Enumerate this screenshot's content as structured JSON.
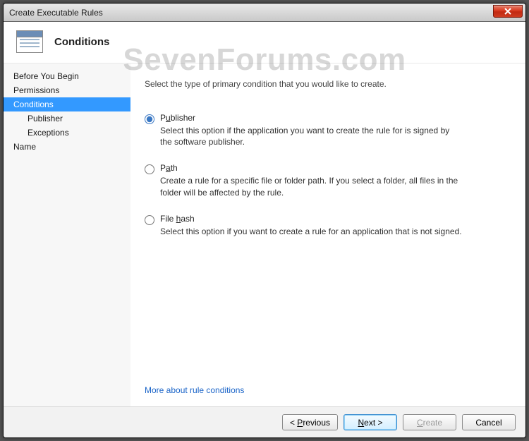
{
  "window": {
    "title": "Create Executable Rules"
  },
  "header": {
    "title": "Conditions"
  },
  "watermark": "SevenForums.com",
  "sidebar": {
    "items": [
      {
        "label": "Before You Begin",
        "selected": false,
        "sub": false
      },
      {
        "label": "Permissions",
        "selected": false,
        "sub": false
      },
      {
        "label": "Conditions",
        "selected": true,
        "sub": false
      },
      {
        "label": "Publisher",
        "selected": false,
        "sub": true
      },
      {
        "label": "Exceptions",
        "selected": false,
        "sub": true
      },
      {
        "label": "Name",
        "selected": false,
        "sub": false
      }
    ]
  },
  "main": {
    "instruction": "Select the type of primary condition that you would like to create.",
    "options": [
      {
        "value": "publisher",
        "label_pre": "P",
        "label_ak": "u",
        "label_post": "blisher",
        "description": "Select this option if the application you want to create the rule for is signed by the software publisher.",
        "checked": true
      },
      {
        "value": "path",
        "label_pre": "P",
        "label_ak": "a",
        "label_post": "th",
        "description": "Create a rule for a specific file or folder path. If you select a folder, all files in the folder will be affected by the rule.",
        "checked": false
      },
      {
        "value": "filehash",
        "label_pre": "File ",
        "label_ak": "h",
        "label_post": "ash",
        "description": "Select this option if you want to create a rule for an application that is not signed.",
        "checked": false
      }
    ],
    "help_link": "More about rule conditions"
  },
  "footer": {
    "previous_pre": "< ",
    "previous_ak": "P",
    "previous_post": "revious",
    "next_pre": "",
    "next_ak": "N",
    "next_post": "ext >",
    "create_pre": "",
    "create_ak": "C",
    "create_post": "reate",
    "cancel": "Cancel",
    "create_disabled": true
  }
}
